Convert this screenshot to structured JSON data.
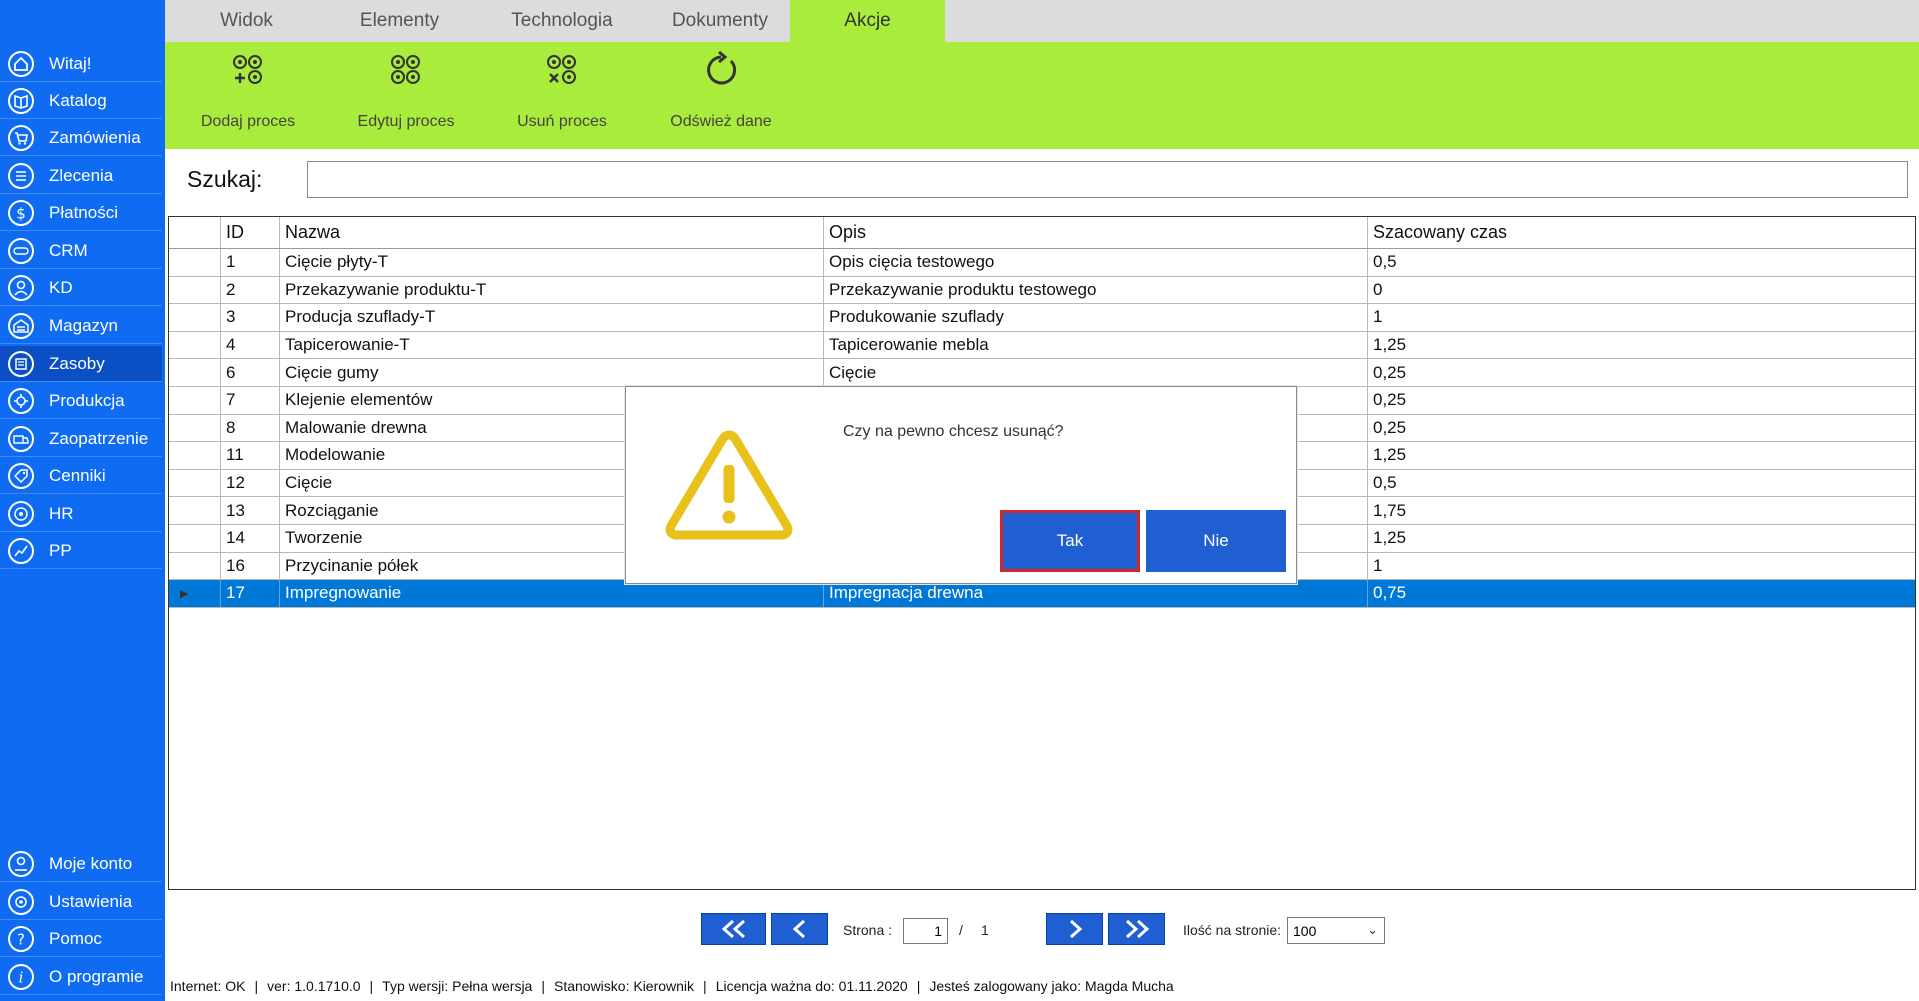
{
  "sidebar": {
    "items": [
      {
        "label": "Witaj!",
        "icon": "home-icon"
      },
      {
        "label": "Katalog",
        "icon": "book-icon"
      },
      {
        "label": "Zamówienia",
        "icon": "cart-icon"
      },
      {
        "label": "Zlecenia",
        "icon": "list-icon"
      },
      {
        "label": "Płatności",
        "icon": "dollar-icon"
      },
      {
        "label": "CRM",
        "icon": "crm-icon"
      },
      {
        "label": "KD",
        "icon": "person-icon"
      },
      {
        "label": "Magazyn",
        "icon": "warehouse-icon"
      },
      {
        "label": "Zasoby",
        "icon": "resources-icon"
      },
      {
        "label": "Produkcja",
        "icon": "production-icon"
      },
      {
        "label": "Zaopatrzenie",
        "icon": "truck-icon"
      },
      {
        "label": "Cenniki",
        "icon": "tag-icon"
      },
      {
        "label": "HR",
        "icon": "hr-icon"
      },
      {
        "label": "PP",
        "icon": "chart-icon"
      }
    ],
    "bottom": [
      {
        "label": "Moje konto",
        "icon": "account-icon"
      },
      {
        "label": "Ustawienia",
        "icon": "settings-icon"
      },
      {
        "label": "Pomoc",
        "icon": "help-icon"
      },
      {
        "label": "O programie",
        "icon": "info-icon"
      }
    ]
  },
  "tabs": [
    {
      "label": "Widok"
    },
    {
      "label": "Elementy"
    },
    {
      "label": "Technologia"
    },
    {
      "label": "Dokumenty"
    },
    {
      "label": "Akcje"
    }
  ],
  "toolbar": {
    "add": "Dodaj proces",
    "edit": "Edytuj proces",
    "delete": "Usuń proces",
    "refresh": "Odśwież dane"
  },
  "search": {
    "label": "Szukaj:",
    "value": ""
  },
  "table": {
    "headers": {
      "id": "ID",
      "name": "Nazwa",
      "desc": "Opis",
      "time": "Szacowany czas"
    },
    "rows": [
      {
        "id": "1",
        "name": "Cięcie płyty-T",
        "desc": "Opis cięcia testowego",
        "time": "0,5"
      },
      {
        "id": "2",
        "name": "Przekazywanie produktu-T",
        "desc": "Przekazywanie produktu testowego",
        "time": "0"
      },
      {
        "id": "3",
        "name": "Producja szuflady-T",
        "desc": "Produkowanie szuflady",
        "time": "1"
      },
      {
        "id": "4",
        "name": "Tapicerowanie-T",
        "desc": "Tapicerowanie mebla",
        "time": "1,25"
      },
      {
        "id": "6",
        "name": "Cięcie gumy",
        "desc": "Cięcie",
        "time": "0,25"
      },
      {
        "id": "7",
        "name": "Klejenie elementów",
        "desc": "",
        "time": "0,25"
      },
      {
        "id": "8",
        "name": "Malowanie drewna",
        "desc": "",
        "time": "0,25"
      },
      {
        "id": "11",
        "name": "Modelowanie",
        "desc": "",
        "time": "1,25"
      },
      {
        "id": "12",
        "name": "Cięcie",
        "desc": "",
        "time": "0,5"
      },
      {
        "id": "13",
        "name": "Rozciąganie",
        "desc": "",
        "time": "1,75"
      },
      {
        "id": "14",
        "name": "Tworzenie",
        "desc": "",
        "time": "1,25"
      },
      {
        "id": "16",
        "name": "Przycinanie półek",
        "desc": "",
        "time": "1"
      },
      {
        "id": "17",
        "name": "Impregnowanie",
        "desc": "Impregnacja drewna",
        "time": "0,75"
      }
    ]
  },
  "dialog": {
    "message": "Czy na pewno chcesz usunąć?",
    "yes": "Tak",
    "no": "Nie"
  },
  "pager": {
    "page_label": "Strona :",
    "page": "1",
    "separator": "/",
    "total": "1",
    "per_page_label": "Ilość na stronie:",
    "per_page": "100"
  },
  "status": {
    "internet": "Internet: OK",
    "version": "ver: 1.0.1710.0",
    "type": "Typ wersji: Pełna wersja",
    "station": "Stanowisko: Kierownik",
    "license": "Licencja ważna do: 01.11.2020",
    "user": "Jesteś zalogowany jako: Magda Mucha"
  },
  "colors": {
    "sidebar": "#0f6cf2",
    "accent_green": "#a9ec3c",
    "button_blue": "#1f5fd2",
    "selection": "#0078d7",
    "warning": "#e8c11a"
  }
}
